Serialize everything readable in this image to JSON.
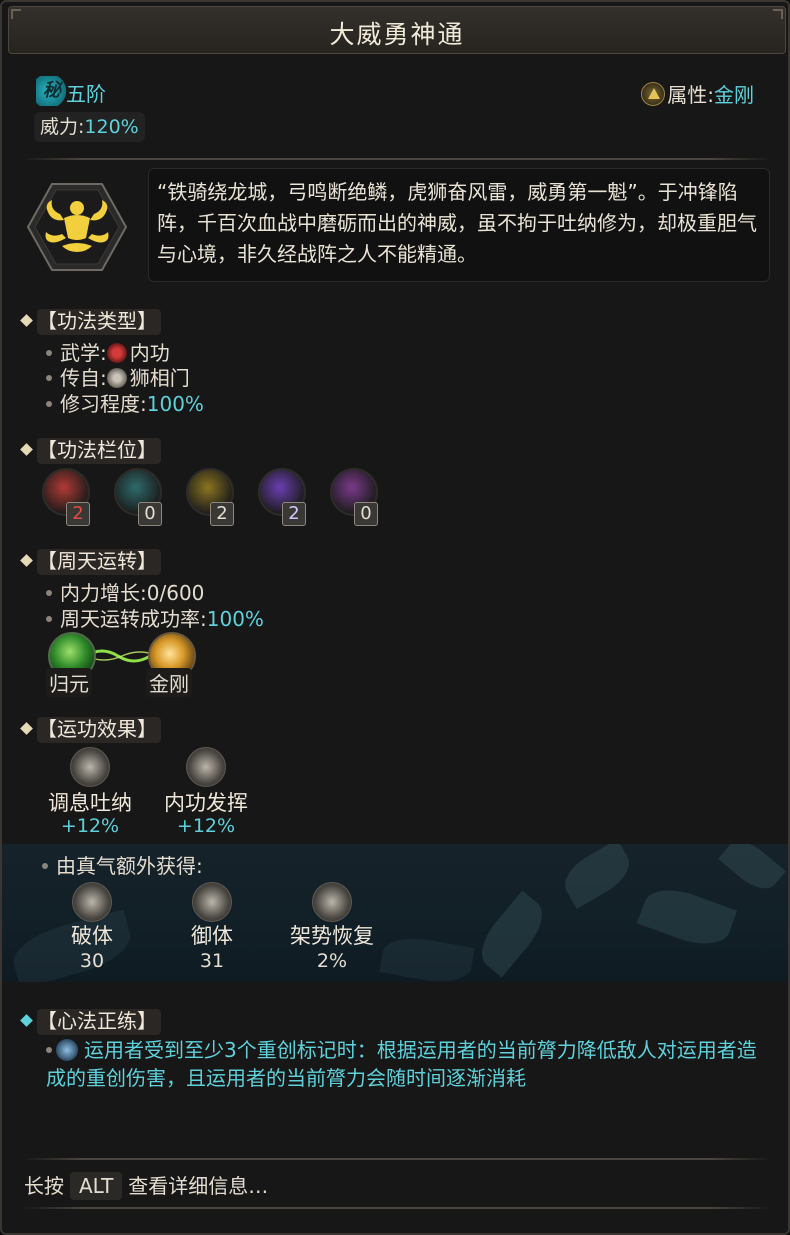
{
  "title": "大威勇神通",
  "rank": {
    "badge": "秘",
    "text": "五阶"
  },
  "power": {
    "label": "威力:",
    "value": "120%"
  },
  "attribute": {
    "label": "属性:",
    "value": "金刚",
    "icon": "vajra-triangle-icon"
  },
  "description": "“铁骑绕龙城，弓鸣断绝鳞，虎狮奋风雷，威勇第一魁”。于冲锋陷阵，千百次血战中磨砺而出的神威，虽不拘于吐纳修为，却极重胆气与心境，非久经战阵之人不能精通。",
  "type_section": {
    "header": "【功法类型】",
    "school_label": "武学:",
    "school_value": "内功",
    "origin_label": "传自:",
    "origin_value": "狮相门",
    "mastery_label": "修习程度:",
    "mastery_value": "100%"
  },
  "slot_section": {
    "header": "【功法栏位】",
    "slots": [
      {
        "count": "2",
        "color": "#b23a34",
        "num_color": "#e44b44"
      },
      {
        "count": "0",
        "color": "#2f6a6a",
        "num_color": "#e4ddd0"
      },
      {
        "count": "2",
        "color": "#8a7420",
        "num_color": "#e4ddd0"
      },
      {
        "count": "2",
        "color": "#6a3fb0",
        "num_color": "#d5c8ff"
      },
      {
        "count": "0",
        "color": "#7a3a8a",
        "num_color": "#e4ddd0"
      }
    ]
  },
  "circulation_section": {
    "header": "【周天运转】",
    "growth_label": "内力增长:",
    "growth_value": "0/600",
    "rate_label": "周天运转成功率:",
    "rate_value": "100%",
    "nodes": [
      {
        "label": "归元"
      },
      {
        "label": "金刚"
      }
    ]
  },
  "effect_section": {
    "header": "【运功效果】",
    "effects": [
      {
        "name": "调息吐纳",
        "value": "+12%"
      },
      {
        "name": "内功发挥",
        "value": "+12%"
      }
    ],
    "bonus_label": "由真气额外获得:",
    "bonuses": [
      {
        "name": "破体",
        "value": "30"
      },
      {
        "name": "御体",
        "value": "31"
      },
      {
        "name": "架势恢复",
        "value": "2%"
      }
    ]
  },
  "mind_section": {
    "header": "【心法正练】",
    "text": "运用者受到至少3个重创标记时：根据运用者的当前膂力降低敌人对运用者造成的重创伤害，且运用者的当前膂力会随时间逐渐消耗"
  },
  "footer": {
    "prefix": "长按",
    "key": "ALT",
    "suffix": "查看详细信息…"
  },
  "colors": {
    "accent_teal": "#5fd1db",
    "gold": "#e6c35a",
    "panel": "#171717"
  }
}
